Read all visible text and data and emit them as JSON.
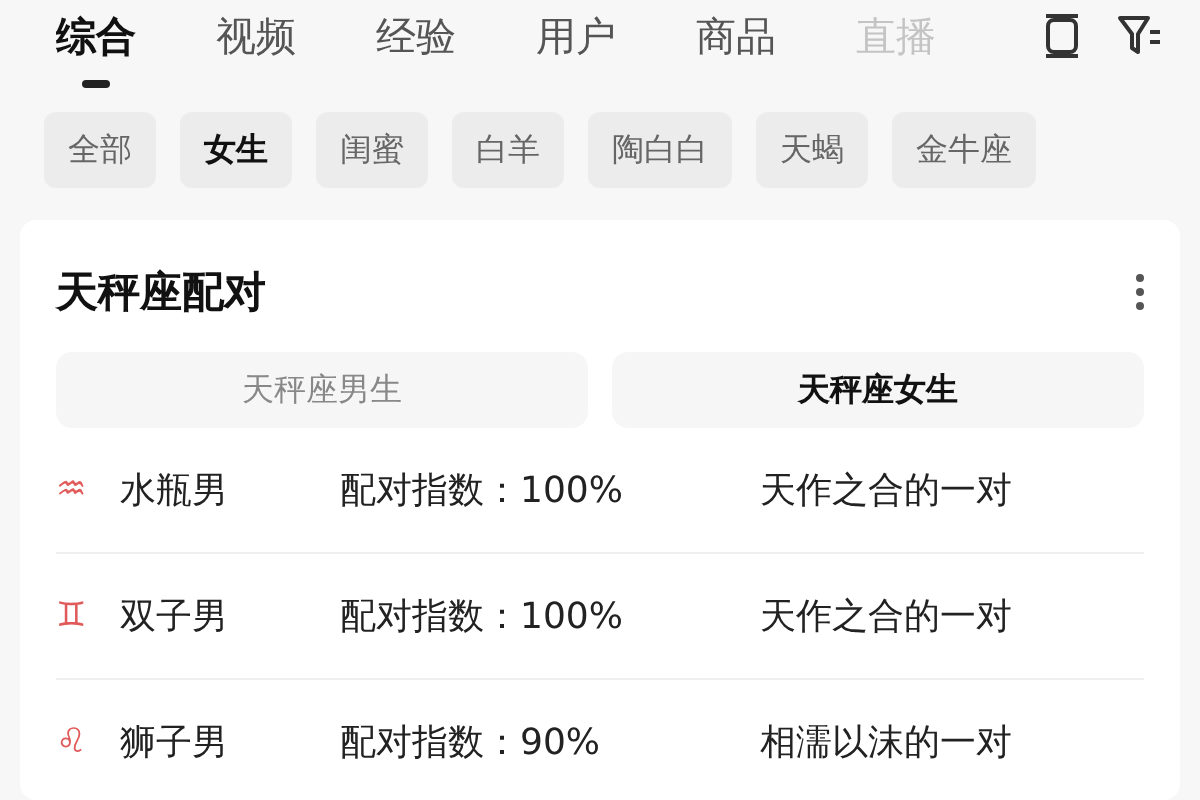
{
  "tabs": [
    {
      "label": "综合",
      "selected": true
    },
    {
      "label": "视频",
      "selected": false
    },
    {
      "label": "经验",
      "selected": false
    },
    {
      "label": "用户",
      "selected": false
    },
    {
      "label": "商品",
      "selected": false
    },
    {
      "label": "直播",
      "selected": false
    }
  ],
  "chips": [
    {
      "label": "全部",
      "selected": false
    },
    {
      "label": "女生",
      "selected": true
    },
    {
      "label": "闺蜜",
      "selected": false
    },
    {
      "label": "白羊",
      "selected": false
    },
    {
      "label": "陶白白",
      "selected": false
    },
    {
      "label": "天蝎",
      "selected": false
    },
    {
      "label": "金牛座",
      "selected": false
    }
  ],
  "card": {
    "title": "天秤座配对",
    "toggle": [
      {
        "label": "天秤座男生",
        "selected": false
      },
      {
        "label": "天秤座女生",
        "selected": true
      }
    ],
    "rows": [
      {
        "symbol": "♒",
        "name": "水瓶男",
        "score": "配对指数：100%",
        "verdict": "天作之合的一对"
      },
      {
        "symbol": "♊",
        "name": "双子男",
        "score": "配对指数：100%",
        "verdict": "天作之合的一对"
      },
      {
        "symbol": "♌",
        "name": "狮子男",
        "score": "配对指数：90%",
        "verdict": "相濡以沫的一对"
      }
    ]
  }
}
